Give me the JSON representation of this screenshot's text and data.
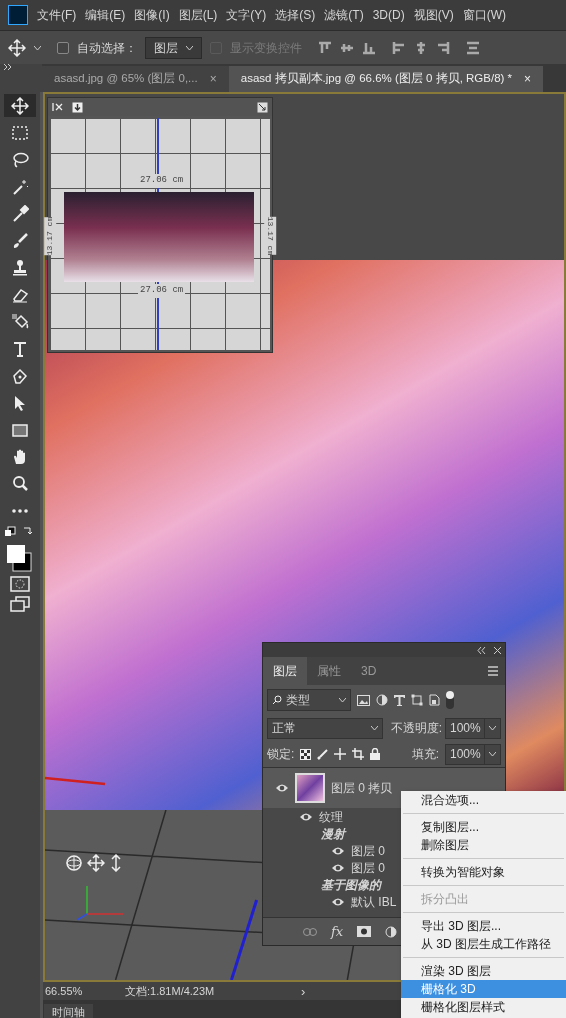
{
  "menu_bar": {
    "items": [
      "文件(F)",
      "编辑(E)",
      "图像(I)",
      "图层(L)",
      "文字(Y)",
      "选择(S)",
      "滤镜(T)",
      "3D(D)",
      "视图(V)",
      "窗口(W)"
    ]
  },
  "options_bar": {
    "auto_select": {
      "label": "自动选择：",
      "checked": false
    },
    "target": "图层",
    "show_transform": {
      "label": "显示变换控件",
      "checked": false,
      "disabled": true
    }
  },
  "doc_tabs": [
    {
      "title": "asasd.jpg @ 65% (图层 0,...",
      "close": "×",
      "selected": false
    },
    {
      "title": "asasd 拷贝副本.jpg @ 66.6% (图层 0 拷贝, RGB/8) *",
      "close": "×",
      "selected": true
    }
  ],
  "tools": [
    {
      "kind": "move",
      "selected": true
    },
    {
      "kind": "marquee",
      "selected": false
    },
    {
      "kind": "lasso",
      "selected": false
    },
    {
      "kind": "wand",
      "selected": false
    },
    {
      "kind": "eyedropper",
      "selected": false
    },
    {
      "kind": "brush",
      "selected": false
    },
    {
      "kind": "stamp",
      "selected": false
    },
    {
      "kind": "eraser",
      "selected": false
    },
    {
      "kind": "bucket",
      "selected": false
    },
    {
      "kind": "type",
      "selected": false
    },
    {
      "kind": "pen",
      "selected": false
    },
    {
      "kind": "select",
      "selected": false
    },
    {
      "kind": "rect",
      "selected": false
    },
    {
      "kind": "hand",
      "selected": false
    },
    {
      "kind": "zoom",
      "selected": false
    },
    {
      "kind": "more",
      "selected": false
    }
  ],
  "preview_3d": {
    "width_top": "27.06 cm",
    "width_bottom": "27.06 cm",
    "height_left": "13.17 cm",
    "height_right": "13.17 cm"
  },
  "layers_panel": {
    "tabs": [
      {
        "label": "图层",
        "selected": true
      },
      {
        "label": "属性",
        "selected": false
      },
      {
        "label": "3D",
        "selected": false
      }
    ],
    "filter": "类型",
    "blend_mode": "正常",
    "opacity_label": "不透明度:",
    "opacity": "100%",
    "lock_label": "锁定:",
    "fill_label": "填充:",
    "fill": "100%",
    "effects_label": "fx",
    "layers": [
      {
        "name": "图层 0 拷贝",
        "visible": true,
        "kind": "layer",
        "children": [
          {
            "name": "纹理",
            "visible": true,
            "kind": "layer",
            "children": [
              {
                "name": "漫射",
                "kind": "group",
                "children": [
                  {
                    "name": "图层 0",
                    "visible": true,
                    "kind": "layer"
                  },
                  {
                    "name": "图层 0",
                    "visible": true,
                    "kind": "layer"
                  }
                ]
              },
              {
                "name": "基于图像的",
                "kind": "group",
                "children": [
                  {
                    "name": "默认 IBL",
                    "visible": true,
                    "kind": "layer"
                  }
                ]
              }
            ]
          }
        ]
      }
    ]
  },
  "context_menu": {
    "sections": [
      [
        {
          "label": "混合选项...",
          "disabled": false,
          "selected": false
        }
      ],
      [
        {
          "label": "复制图层...",
          "disabled": false,
          "selected": false
        },
        {
          "label": "删除图层",
          "disabled": false,
          "selected": false
        }
      ],
      [
        {
          "label": "转换为智能对象",
          "disabled": false,
          "selected": false
        }
      ],
      [
        {
          "label": "拆分凸出",
          "disabled": true,
          "selected": false
        }
      ],
      [
        {
          "label": "导出 3D 图层...",
          "disabled": false,
          "selected": false
        },
        {
          "label": "从 3D 图层生成工作路径",
          "disabled": false,
          "selected": false
        }
      ],
      [
        {
          "label": "渲染 3D 图层",
          "disabled": false,
          "selected": false
        },
        {
          "label": "栅格化 3D",
          "disabled": false,
          "selected": true
        },
        {
          "label": "栅格化图层样式",
          "disabled": false,
          "selected": false
        }
      ]
    ]
  },
  "status_bar": {
    "zoom": "66.55%",
    "doc_size": "文档:1.81M/4.23M",
    "arrow": "›"
  },
  "timeline_tab": "时间轴"
}
